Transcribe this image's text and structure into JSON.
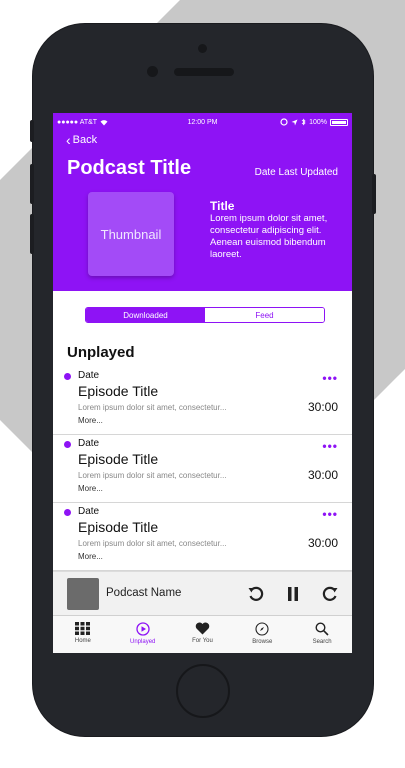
{
  "status_bar": {
    "carrier": "●●●●● AT&T",
    "time": "12:00 PM",
    "battery": "100%"
  },
  "header": {
    "back_label": "Back",
    "podcast_title": "Podcast Title",
    "date_updated": "Date Last Updated",
    "thumbnail_label": "Thumbnail",
    "info_title": "Title",
    "info_description": "Lorem ipsum dolor sit amet, consectetur adipiscing elit. Aenean euismod bibendum laoreet."
  },
  "segments": [
    {
      "label": "Downloaded",
      "active": true
    },
    {
      "label": "Feed",
      "active": false
    }
  ],
  "section_title": "Unplayed",
  "episodes": [
    {
      "date": "Date",
      "title": "Episode Title",
      "description": "Lorem ipsum dolor sit amet, consectetur...",
      "more": "More...",
      "duration": "30:00"
    },
    {
      "date": "Date",
      "title": "Episode Title",
      "description": "Lorem ipsum dolor sit amet, consectetur...",
      "more": "More...",
      "duration": "30:00"
    },
    {
      "date": "Date",
      "title": "Episode Title",
      "description": "Lorem ipsum dolor sit amet, consectetur...",
      "more": "More...",
      "duration": "30:00"
    }
  ],
  "player": {
    "podcast_name": "Podcast Name",
    "controls": [
      "rewind-icon",
      "pause-icon",
      "forward-icon"
    ]
  },
  "tabs": [
    {
      "label": "Home",
      "icon": "grid-icon",
      "active": false
    },
    {
      "label": "Unplayed",
      "icon": "play-circle-icon",
      "active": true
    },
    {
      "label": "For You",
      "icon": "heart-icon",
      "active": false
    },
    {
      "label": "Browse",
      "icon": "compass-icon",
      "active": false
    },
    {
      "label": "Search",
      "icon": "search-icon",
      "active": false
    }
  ],
  "colors": {
    "accent": "#8e13f5",
    "thumbnail": "#a34bf7",
    "phone_body": "#24262b"
  }
}
